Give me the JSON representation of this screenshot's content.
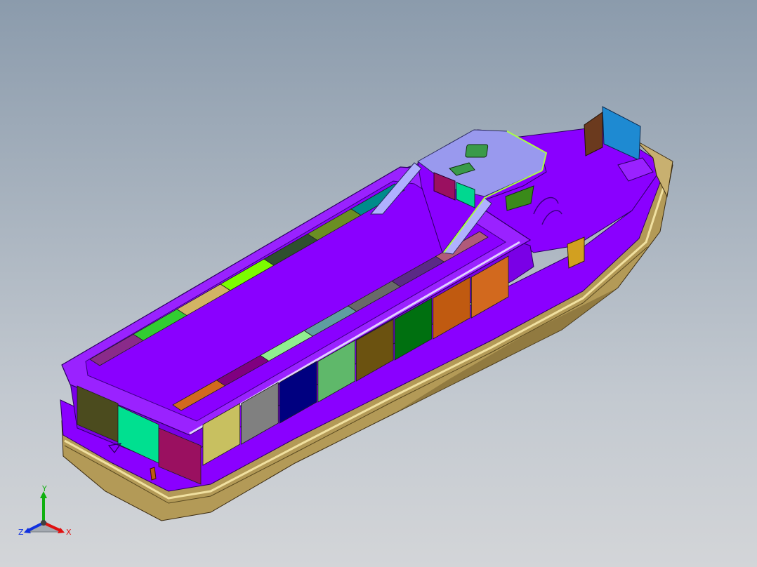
{
  "viewport": {
    "background_top": "#8b9bac",
    "background_bottom": "#d3d5d8"
  },
  "model": {
    "hull_color": "#8a00ff",
    "hull_dark": "#6a00cc",
    "keel_color": "#b39a57",
    "pilothouse_color": "#9999ee",
    "panel_colors": [
      "#8a2b8a",
      "#32cd32",
      "#d2b464",
      "#7cfc00",
      "#2f4f2f",
      "#6b8e23",
      "#008b8b",
      "#d2691e",
      "#800080",
      "#90ee90",
      "#5f9ea0",
      "#696969",
      "#5b2a86",
      "#b05a7a",
      "#4b4b1e",
      "#00e090",
      "#9a1060",
      "#c8c060",
      "#808080",
      "#000080",
      "#5fb86a",
      "#6b5210",
      "#007010",
      "#c05a10",
      "#d2691e",
      "#1e7ad2",
      "#6b3a1e"
    ]
  },
  "triad": {
    "x_label": "X",
    "y_label": "Y",
    "z_label": "Z",
    "x_color": "#e01010",
    "y_color": "#10b010",
    "z_color": "#1030e0"
  }
}
